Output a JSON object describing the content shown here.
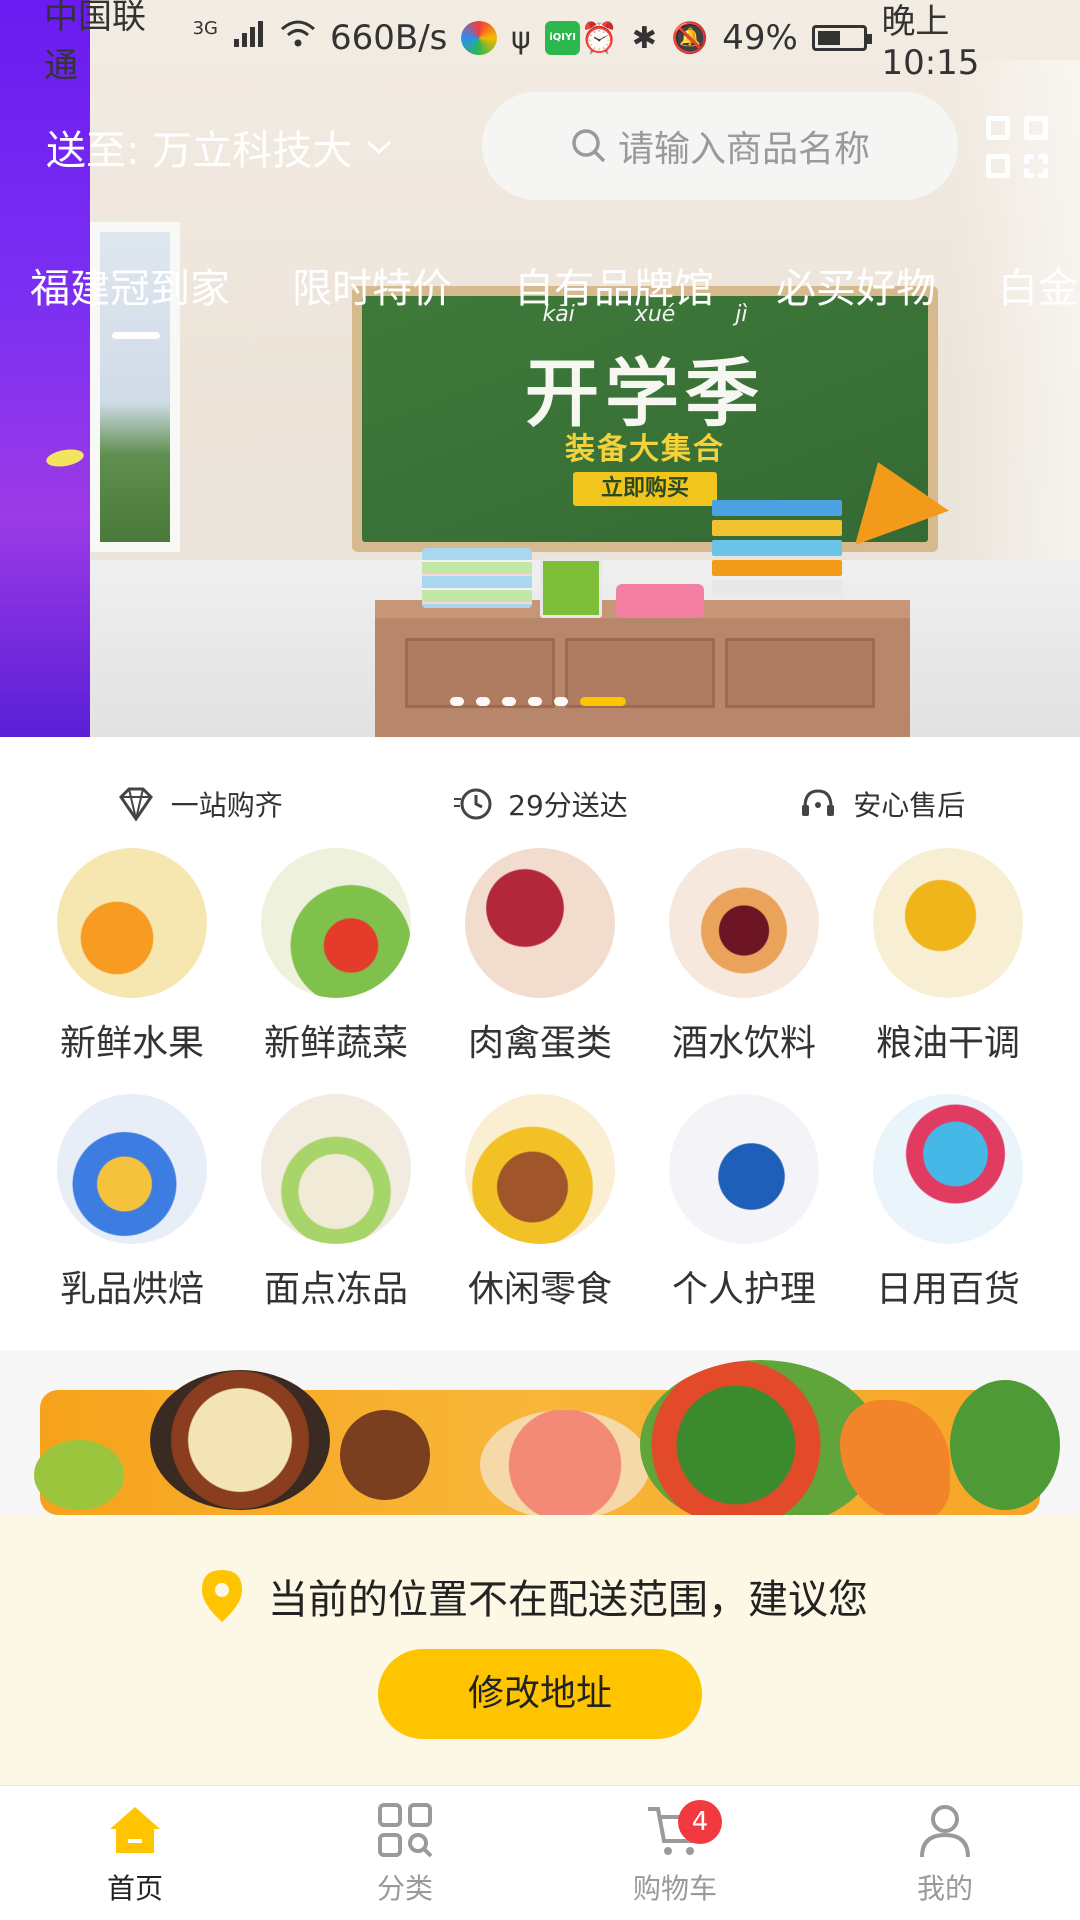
{
  "status_bar": {
    "carrier": "中国联通",
    "network": "3G",
    "speed": "660B/s",
    "app_badge": "iQIYI",
    "battery": "49%",
    "time": "晚上10:15",
    "icons": [
      "signal-icon",
      "wifi-icon",
      "usb-icon",
      "alarm-icon",
      "bluetooth-icon",
      "mute-icon",
      "battery-icon"
    ]
  },
  "header": {
    "address_label": "送至: 万立科技大",
    "search_placeholder": "请输入商品名称"
  },
  "tabs": [
    {
      "label": "福建冠到家",
      "active": true
    },
    {
      "label": "限时特价"
    },
    {
      "label": "自有品牌馆"
    },
    {
      "label": "必买好物"
    },
    {
      "label": "白金"
    }
  ],
  "banner": {
    "pinyin": [
      "kāi",
      "xué",
      "jì"
    ],
    "title": "开学季",
    "subtitle": "装备大集合",
    "cta": "立即购买",
    "slide_count": 6,
    "active_slide": 6
  },
  "features": [
    {
      "label": "一站购齐",
      "icon": "diamond-icon"
    },
    {
      "label": "29分送达",
      "icon": "delivery-clock-icon"
    },
    {
      "label": "安心售后",
      "icon": "headset-icon"
    }
  ],
  "categories": [
    {
      "label": "新鲜水果"
    },
    {
      "label": "新鲜蔬菜"
    },
    {
      "label": "肉禽蛋类"
    },
    {
      "label": "酒水饮料"
    },
    {
      "label": "粮油干调"
    },
    {
      "label": "乳品烘焙"
    },
    {
      "label": "面点冻品"
    },
    {
      "label": "休闲零食"
    },
    {
      "label": "个人护理"
    },
    {
      "label": "日用百货"
    }
  ],
  "notice": {
    "text": "当前的位置不在配送范围，建议您",
    "button": "修改地址"
  },
  "nav": [
    {
      "label": "首页",
      "icon": "home-icon",
      "active": true
    },
    {
      "label": "分类",
      "icon": "grid-search-icon"
    },
    {
      "label": "购物车",
      "icon": "cart-icon",
      "badge": "4"
    },
    {
      "label": "我的",
      "icon": "user-icon"
    }
  ],
  "colors": {
    "accent": "#ffc400",
    "badge": "#f2393f",
    "notice_bg": "#fdf7e5"
  }
}
